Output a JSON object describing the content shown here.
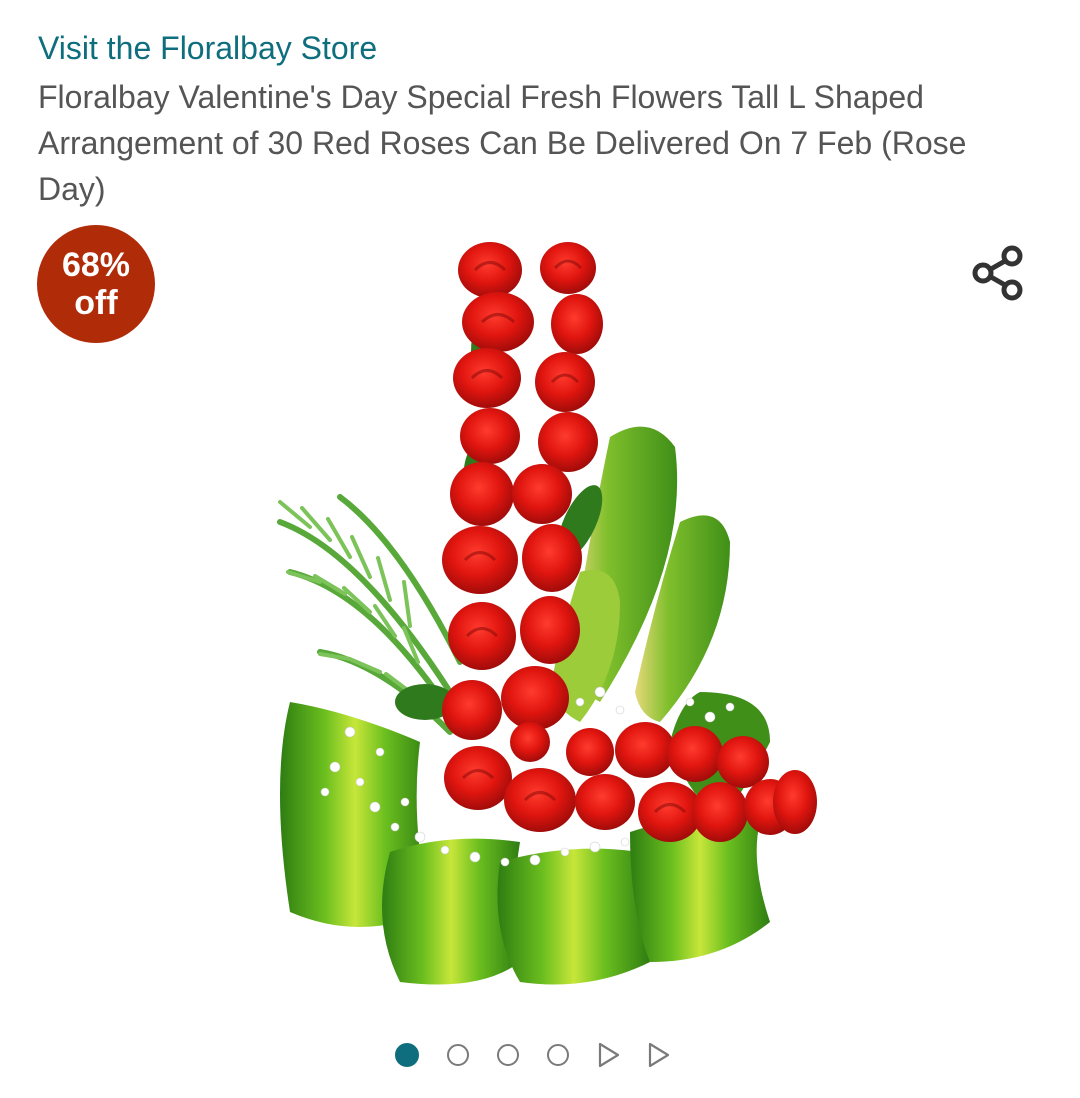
{
  "store_link": {
    "label": "Visit the Floralbay Store"
  },
  "product": {
    "title": "Floralbay Valentine's Day Special Fresh Flowers Tall L Shaped Arrangement of 30 Red Roses Can Be Delivered On 7 Feb (Rose Day)"
  },
  "badge": {
    "percent": "68%",
    "off": "off",
    "color": "#b02b07"
  },
  "share": {
    "icon": "share-icon"
  },
  "carousel": {
    "total_images": 4,
    "total_videos": 2,
    "active_index": 0,
    "accent_color": "#0f6e7d"
  },
  "theme": {
    "link_color": "#0f6e7d",
    "title_color": "#555555"
  }
}
